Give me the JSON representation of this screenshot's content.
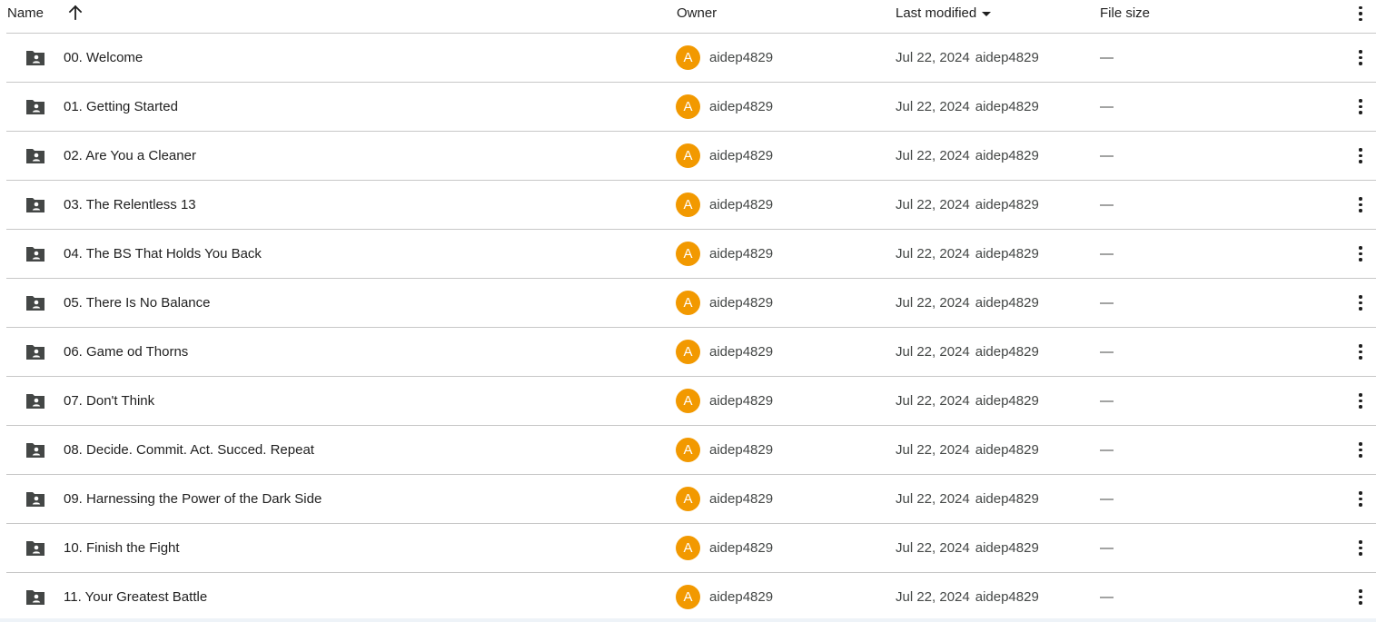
{
  "columns": {
    "name": "Name",
    "owner": "Owner",
    "last_modified": "Last modified",
    "file_size": "File size"
  },
  "sort": {
    "column": "name",
    "direction": "ascending",
    "icon": "arrow-up-icon"
  },
  "colors": {
    "avatar": "#f29900",
    "divider": "#c7c7c7",
    "folder_icon": "#444746"
  },
  "rows": [
    {
      "name": "00. Welcome",
      "avatar_letter": "A",
      "owner": "aidep4829",
      "modified_date": "Jul 22, 2024",
      "modified_by": "aidep4829",
      "size": "—"
    },
    {
      "name": "01. Getting Started",
      "avatar_letter": "A",
      "owner": "aidep4829",
      "modified_date": "Jul 22, 2024",
      "modified_by": "aidep4829",
      "size": "—"
    },
    {
      "name": "02. Are You a Cleaner",
      "avatar_letter": "A",
      "owner": "aidep4829",
      "modified_date": "Jul 22, 2024",
      "modified_by": "aidep4829",
      "size": "—"
    },
    {
      "name": "03. The Relentless 13",
      "avatar_letter": "A",
      "owner": "aidep4829",
      "modified_date": "Jul 22, 2024",
      "modified_by": "aidep4829",
      "size": "—"
    },
    {
      "name": "04. The BS That Holds You Back",
      "avatar_letter": "A",
      "owner": "aidep4829",
      "modified_date": "Jul 22, 2024",
      "modified_by": "aidep4829",
      "size": "—"
    },
    {
      "name": "05. There Is No Balance",
      "avatar_letter": "A",
      "owner": "aidep4829",
      "modified_date": "Jul 22, 2024",
      "modified_by": "aidep4829",
      "size": "—"
    },
    {
      "name": "06. Game od Thorns",
      "avatar_letter": "A",
      "owner": "aidep4829",
      "modified_date": "Jul 22, 2024",
      "modified_by": "aidep4829",
      "size": "—"
    },
    {
      "name": "07. Don't Think",
      "avatar_letter": "A",
      "owner": "aidep4829",
      "modified_date": "Jul 22, 2024",
      "modified_by": "aidep4829",
      "size": "—"
    },
    {
      "name": "08. Decide. Commit. Act. Succed. Repeat",
      "avatar_letter": "A",
      "owner": "aidep4829",
      "modified_date": "Jul 22, 2024",
      "modified_by": "aidep4829",
      "size": "—"
    },
    {
      "name": "09. Harnessing the Power of the Dark Side",
      "avatar_letter": "A",
      "owner": "aidep4829",
      "modified_date": "Jul 22, 2024",
      "modified_by": "aidep4829",
      "size": "—"
    },
    {
      "name": "10. Finish the Fight",
      "avatar_letter": "A",
      "owner": "aidep4829",
      "modified_date": "Jul 22, 2024",
      "modified_by": "aidep4829",
      "size": "—"
    },
    {
      "name": "11. Your Greatest Battle",
      "avatar_letter": "A",
      "owner": "aidep4829",
      "modified_date": "Jul 22, 2024",
      "modified_by": "aidep4829",
      "size": "—"
    }
  ]
}
